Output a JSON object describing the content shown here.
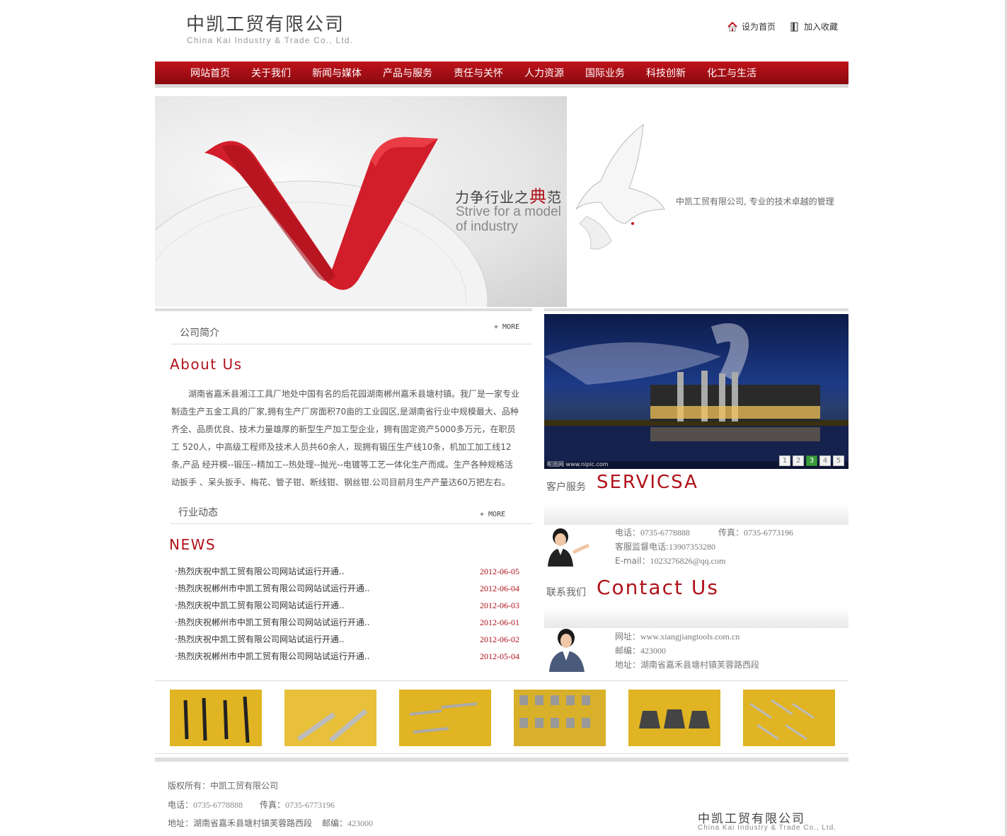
{
  "header": {
    "logo_cn": "中凯工贸有限公司",
    "logo_en": "China Kai Industry & Trade Co., Ltd.",
    "set_home": "设为首页",
    "add_fav": "加入收藏"
  },
  "nav": [
    "网站首页",
    "关于我们",
    "新闻与媒体",
    "产品与服务",
    "责任与关怀",
    "人力资源",
    "国际业务",
    "科技创新",
    "化工与生活"
  ],
  "banner": {
    "slogan_cn_prefix": "力争行业之",
    "slogan_cn_accent": "典",
    "slogan_cn_suffix": "范",
    "slogan_en": "Strive for a model of industry",
    "caption": "中凯工贸有限公司, 专业的技术卓越的管理"
  },
  "about": {
    "title": "公司简介",
    "more": "+ MORE",
    "heading_en": "About Us",
    "text": "湖南省嘉禾县湘江工具厂地处中国有名的后花园湖南郴州嘉禾县塘村镇。我厂是一家专业 制造生产五金工具的厂家,拥有生产厂房面积70亩的工业园区,是湖南省行业中规模最大、品种 齐全、品质优良、技术力量雄厚的新型生产加工型企业，拥有固定资产5000多万元，在职员工 520人，中高级工程师及技术人员共60余人，现拥有锻压生产线10条，机加工加工线12条,产品 经开模--锻压--精加工--热处理--抛光--电镀等工艺一体化生产而成。生产各种规格活动扳手 、呆头扳手、梅花、管子钳、断线钳、钢丝钳.公司目前月生产产量达60万把左右。"
  },
  "news": {
    "title": "行业动态",
    "more": "+ MORE",
    "heading_en": "NEWS",
    "items": [
      {
        "title": "·热烈庆祝中凯工贸有限公司网站试运行开通..",
        "date": "2012-06-05"
      },
      {
        "title": "·热烈庆祝郴州市中凯工贸有限公司网站试运行开通..",
        "date": "2012-06-04"
      },
      {
        "title": "·热烈庆祝中凯工贸有限公司网站试运行开通..",
        "date": "2012-06-03"
      },
      {
        "title": "·热烈庆祝郴州市中凯工贸有限公司网站试运行开通..",
        "date": "2012-06-01"
      },
      {
        "title": "·热烈庆祝中凯工贸有限公司网站试运行开通..",
        "date": "2012-06-02"
      },
      {
        "title": "·热烈庆祝郴州市中凯工贸有限公司网站试运行开通..",
        "date": "2012-05-04"
      }
    ]
  },
  "slider": {
    "pages": [
      "1",
      "2",
      "3",
      "4",
      "5"
    ],
    "active": "3",
    "watermark": "昵图网 www.nipic.com"
  },
  "service": {
    "label_cn": "客户服务",
    "label_en": "SERVICSA",
    "phone_label": "电话：",
    "phone": "0735-6778888",
    "fax_label": "传真：",
    "fax": "0735-6773196",
    "supervise_label": "客服监督电话:",
    "supervise": "13907353280",
    "email_label": "E-mail：",
    "email": "1023276826@qq.com"
  },
  "contact": {
    "label_cn": "联系我们",
    "label_en": "Contact Us",
    "web_label": "网址：",
    "web": "www.xiangjiangtools.com.cn",
    "zip_label": "邮编：",
    "zip": "423000",
    "addr_label": "地址：",
    "addr": "湖南省嘉禾县塘村镇芙蓉路西段"
  },
  "footer": {
    "copyright_label": "版权所有：",
    "copyright": "中凯工贸有限公司",
    "phone_label": "电话：",
    "phone": "0735-6778888",
    "fax_label": "传真：",
    "fax": "0735-6773196",
    "addr_label": "地址：",
    "addr": "湖南省嘉禾县塘村镇芙蓉路西段",
    "zip_label": "邮编：",
    "zip": "423000",
    "logo_cn": "中凯工贸有限公司",
    "logo_en": "China Kai Industry & Trade Co., Ltd."
  },
  "colors": {
    "brand_red": "#b0121a",
    "nav_red": "#c0121a",
    "pager_active": "#3a9a3a"
  }
}
